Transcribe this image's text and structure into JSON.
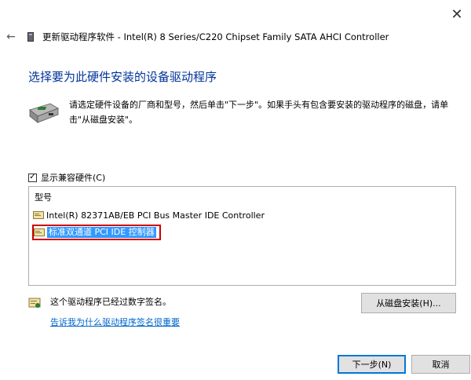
{
  "window": {
    "top_partial_text": "",
    "title": "更新驱动程序软件 - Intel(R) 8 Series/C220 Chipset Family SATA AHCI Controller",
    "close_glyph": "✕",
    "back_glyph": "←"
  },
  "main": {
    "heading": "选择要为此硬件安装的设备驱动程序",
    "instruction": "请选定硬件设备的厂商和型号，然后单击\"下一步\"。如果手头有包含要安装的驱动程序的磁盘，请单击\"从磁盘安装\"。"
  },
  "compat": {
    "label": "显示兼容硬件(C)",
    "checked": true,
    "check_glyph": "✓"
  },
  "model_list": {
    "header": "型号",
    "items": [
      {
        "label": "Intel(R) 82371AB/EB PCI Bus Master IDE Controller",
        "selected": false
      },
      {
        "label": "标准双通道 PCI IDE 控制器",
        "selected": true
      }
    ]
  },
  "signature": {
    "status_text": "这个驱动程序已经过数字签名。",
    "link_text": "告诉我为什么驱动程序签名很重要"
  },
  "buttons": {
    "have_disk": "从磁盘安装(H)...",
    "next": "下一步(N)",
    "cancel": "取消"
  },
  "colors": {
    "heading": "#003399",
    "link": "#0066cc",
    "selection": "#3399ff",
    "highlight_border": "#cc0000"
  },
  "icons": {
    "back": "back-arrow-icon",
    "device": "hardware-device-icon",
    "list_item": "driver-item-icon",
    "signature": "signed-driver-icon",
    "close": "close-icon"
  }
}
